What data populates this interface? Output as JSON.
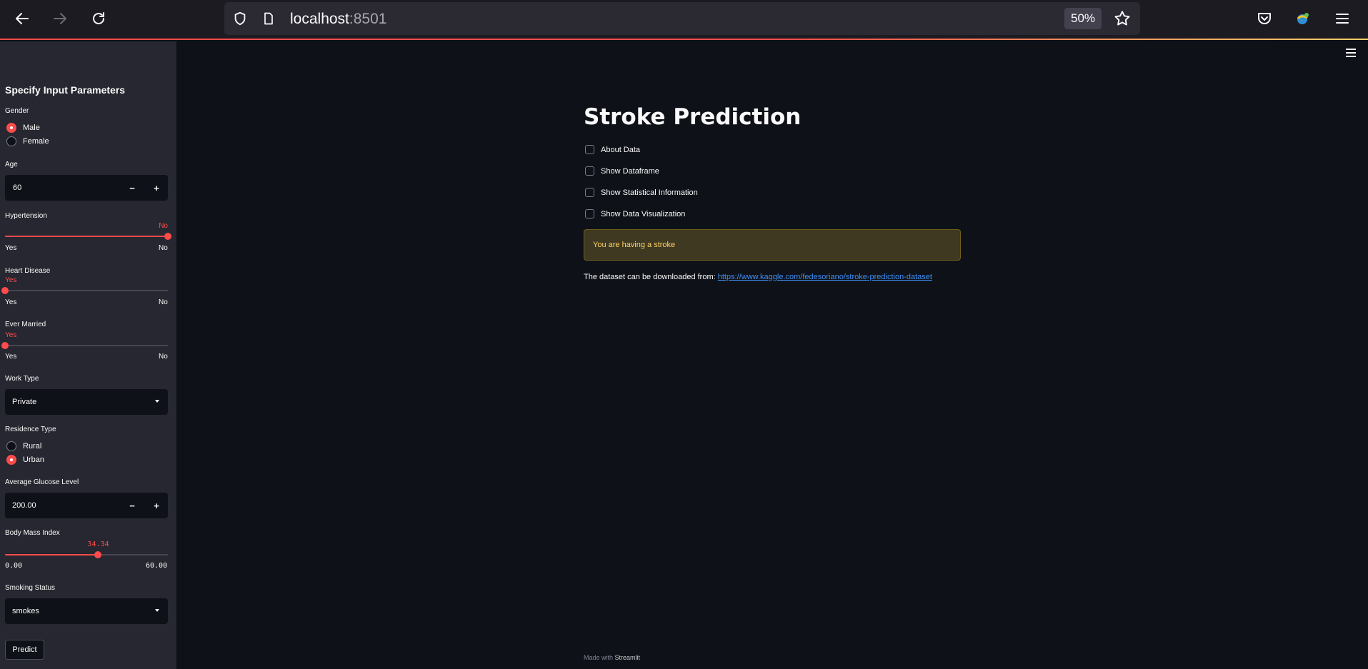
{
  "browser": {
    "url_host": "localhost",
    "url_port": ":8501",
    "zoom": "50%"
  },
  "sidebar": {
    "title": "Specify Input Parameters",
    "gender": {
      "label": "Gender",
      "options": [
        "Male",
        "Female"
      ],
      "selected": "Male"
    },
    "age": {
      "label": "Age",
      "value": "60",
      "minus": "−",
      "plus": "+"
    },
    "hypertension": {
      "label": "Hypertension",
      "current": "No",
      "min_label": "Yes",
      "max_label": "No",
      "position": 1.0
    },
    "heart_disease": {
      "label": "Heart Disease",
      "current": "Yes",
      "min_label": "Yes",
      "max_label": "No",
      "position": 0.0
    },
    "ever_married": {
      "label": "Ever Married",
      "current": "Yes",
      "min_label": "Yes",
      "max_label": "No",
      "position": 0.0
    },
    "work_type": {
      "label": "Work Type",
      "value": "Private"
    },
    "residence": {
      "label": "Residence Type",
      "options": [
        "Rural",
        "Urban"
      ],
      "selected": "Urban"
    },
    "glucose": {
      "label": "Average Glucose Level",
      "value": "200.00",
      "minus": "−",
      "plus": "+"
    },
    "bmi": {
      "label": "Body Mass Index",
      "current": "34.34",
      "min_label": "0.00",
      "max_label": "60.00",
      "value": 34.34,
      "min": 0,
      "max": 60
    },
    "smoking": {
      "label": "Smoking Status",
      "value": "smokes"
    },
    "predict_label": "Predict"
  },
  "main": {
    "title": "Stroke Prediction",
    "checkboxes": [
      "About Data",
      "Show Dataframe",
      "Show Statistical Information",
      "Show Data Visualization"
    ],
    "alert": "You are having a stroke",
    "dataset_prefix": "The dataset can be downloaded from:",
    "dataset_link": "https://www.kaggle.com/fedesoriano/stroke-prediction-dataset",
    "footer_prefix": "Made with",
    "footer_brand": "Streamlit"
  },
  "colors": {
    "accent": "#ff4b4b",
    "warning_text": "#ffd16a",
    "link": "#3f8ef7",
    "background": "#0e1117",
    "sidebar": "#262730"
  }
}
